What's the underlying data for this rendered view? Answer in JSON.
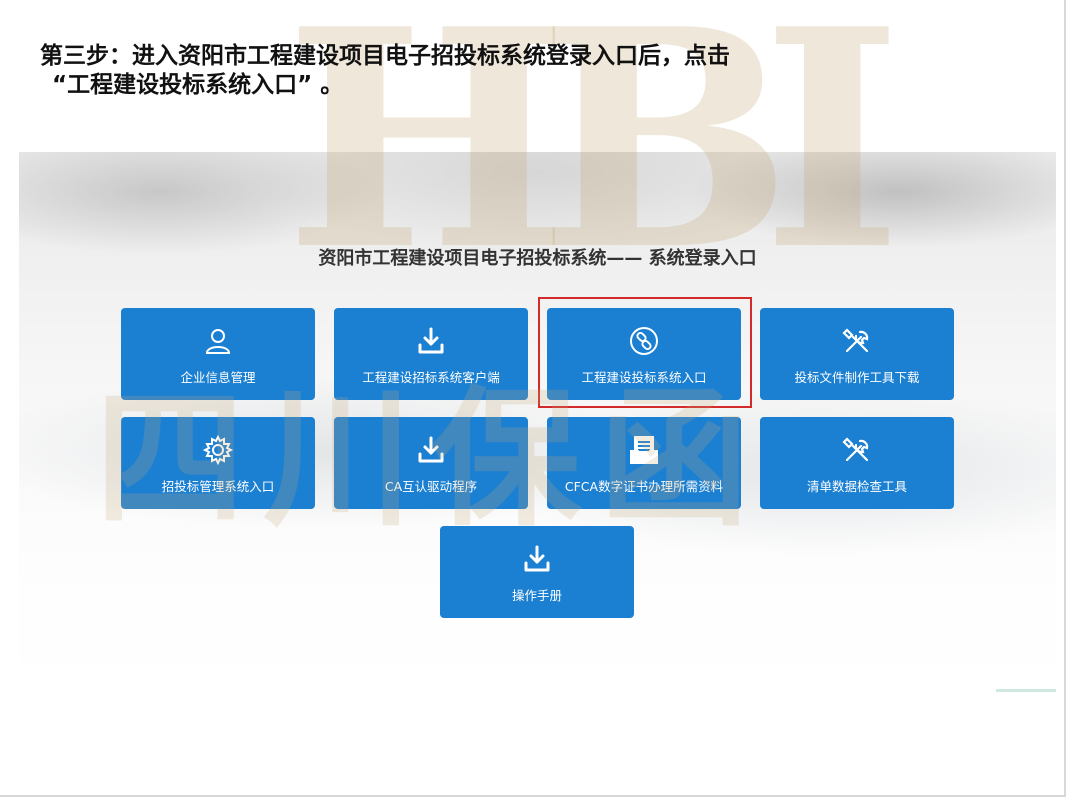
{
  "instruction": {
    "line1": "第三步：进入资阳市工程建设项目电子招投标系统登录入口后，点击",
    "line2": "“工程建设投标系统入口” 。"
  },
  "portal": {
    "title": "资阳市工程建设项目电子招投标系统—— 系统登录入口",
    "tiles": [
      {
        "label": "企业信息管理",
        "icon": "user-icon"
      },
      {
        "label": "工程建设招标系统客户端",
        "icon": "download-icon"
      },
      {
        "label": "工程建设投标系统入口",
        "icon": "link-icon",
        "highlighted": true
      },
      {
        "label": "投标文件制作工具下载",
        "icon": "tools-icon"
      },
      {
        "label": "招投标管理系统入口",
        "icon": "gear-icon"
      },
      {
        "label": "CA互认驱动程序",
        "icon": "download-icon"
      },
      {
        "label": "CFCA数字证书办理所需资料",
        "icon": "document-tray-icon"
      },
      {
        "label": "清单数据检查工具",
        "icon": "tools-icon"
      },
      {
        "label": "操作手册",
        "icon": "download-icon"
      }
    ],
    "tile_color": "#1b7fd2",
    "highlight_color": "#d42a2a"
  },
  "watermark": {
    "letters": "HBI",
    "text": "四川保函"
  }
}
